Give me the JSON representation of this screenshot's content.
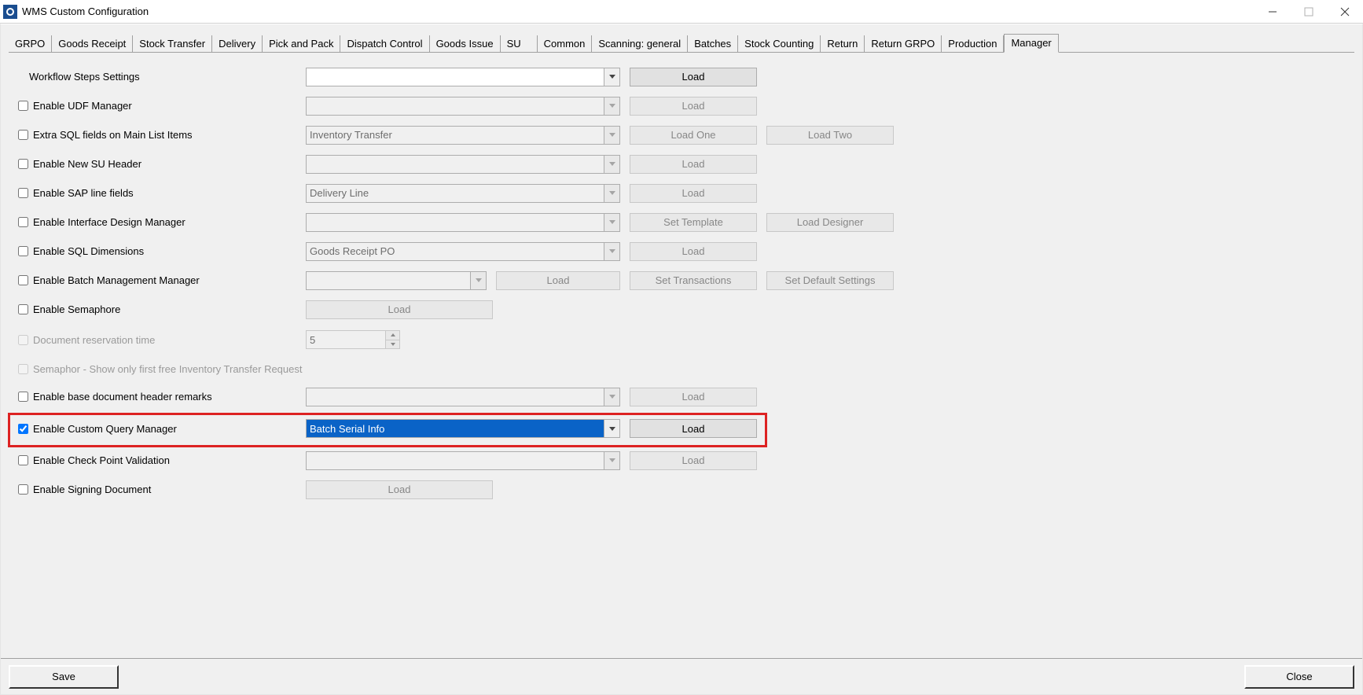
{
  "window": {
    "title": "WMS Custom Configuration"
  },
  "tabs": [
    "GRPO",
    "Goods Receipt",
    "Stock Transfer",
    "Delivery",
    "Pick and Pack",
    "Dispatch Control",
    "Goods Issue",
    "SU",
    "Common",
    "Scanning: general",
    "Batches",
    "Stock Counting",
    "Return",
    "Return GRPO",
    "Production",
    "Manager"
  ],
  "labels": {
    "workflow": "Workflow Steps Settings",
    "udf": "Enable UDF Manager",
    "extraSql": "Extra SQL fields on Main List Items",
    "newSu": "Enable New SU Header",
    "sapLine": "Enable SAP line fields",
    "interfaceDesign": "Enable Interface Design Manager",
    "sqlDim": "Enable SQL Dimensions",
    "batchMgmt": "Enable Batch Management Manager",
    "semaphore": "Enable Semaphore",
    "docResTime": "Document reservation time",
    "semaphorFirst": "Semaphor - Show only first free Inventory Transfer Request",
    "baseDocRemarks": "Enable base document header remarks",
    "customQuery": "Enable Custom Query Manager",
    "checkPoint": "Enable Check Point Validation",
    "signing": "Enable Signing Document"
  },
  "combos": {
    "workflow": "",
    "udf": "",
    "extraSql": "Inventory Transfer",
    "newSu": "",
    "sapLine": "Delivery Line",
    "interfaceDesign": "",
    "sqlDim": "Goods Receipt PO",
    "batchMgmt": "",
    "baseDocRemarks": "",
    "customQuery": "Batch Serial Info",
    "checkPoint": ""
  },
  "spinner": {
    "docResTime": "5"
  },
  "buttons": {
    "load": "Load",
    "loadOne": "Load One",
    "loadTwo": "Load Two",
    "setTemplate": "Set Template",
    "loadDesigner": "Load Designer",
    "setTransactions": "Set Transactions",
    "setDefault": "Set Default Settings",
    "save": "Save",
    "close": "Close"
  }
}
